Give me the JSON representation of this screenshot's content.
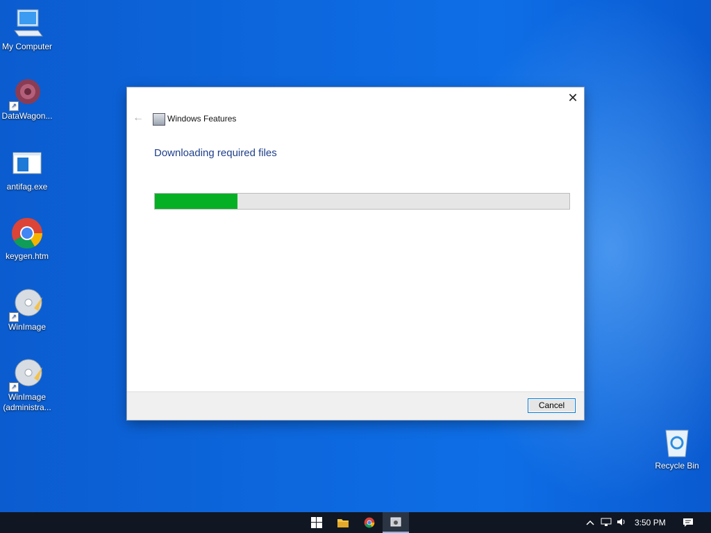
{
  "desktop": {
    "icons": [
      {
        "label": "My Computer"
      },
      {
        "label": "DataWagon..."
      },
      {
        "label": "antifag.exe"
      },
      {
        "label": "keygen.htm"
      },
      {
        "label": "WinImage"
      },
      {
        "label": "WinImage (administra..."
      },
      {
        "label": "Recycle Bin"
      }
    ]
  },
  "dialog": {
    "app_title": "Windows Features",
    "heading": "Downloading required files",
    "progress_fraction": 0.2,
    "cancel_label": "Cancel",
    "close_glyph": "✕",
    "back_glyph": "←"
  },
  "taskbar": {
    "time": "3:50 PM"
  },
  "colors": {
    "progress_fill": "#06b025",
    "heading_text": "#1e3f8a",
    "accent": "#0078d7"
  }
}
